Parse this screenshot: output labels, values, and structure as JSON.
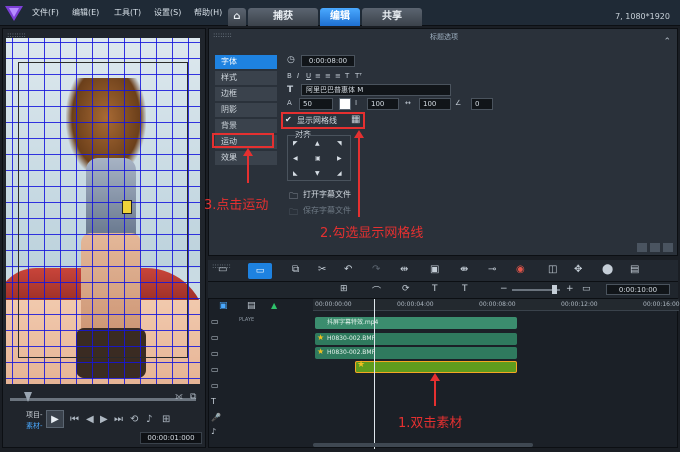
{
  "menubar": {
    "items": [
      "文件(F)",
      "编辑(E)",
      "工具(T)",
      "设置(S)",
      "帮助(H)"
    ],
    "tabs": [
      "捕获",
      "编辑",
      "共享"
    ],
    "active_tab": "编辑",
    "resolution": "7, 1080*1920"
  },
  "preview": {
    "mode_labels": [
      "项目-",
      "素材-"
    ],
    "timecode": "00:00:01:000"
  },
  "options": {
    "title": "标题选项",
    "side_tabs": [
      "字体",
      "样式",
      "边框",
      "阴影",
      "背景",
      "运动",
      "效果"
    ],
    "active_side_tab": "字体",
    "duration": "0:00:08:00",
    "font_name": "阿里巴巴普惠体 M",
    "font_size": "50",
    "line_spacing": "100",
    "char_spacing": "100",
    "rotation": "0",
    "show_grid_label": "显示网格线",
    "show_grid_checked": true,
    "align_label": "对齐",
    "open_subtitle": "打开字幕文件",
    "save_subtitle": "保存字幕文件"
  },
  "timeline": {
    "ticks": [
      "00:00:00:00",
      "00:00:04:00",
      "00:00:08:00",
      "00:00:12:00",
      "00:00:16:00"
    ],
    "end_timecode": "0:00:10:00",
    "track_label": "PLAYE",
    "clips": [
      {
        "name": "抖屏字幕特效.mp4",
        "color": "#3b8d6e"
      },
      {
        "name": "H0830-002.BMP",
        "color": "#2f7a5e"
      },
      {
        "name": "H0830-002.BMP",
        "color": "#2f7a5e"
      },
      {
        "name": "",
        "color": "#5f9c1d"
      }
    ]
  },
  "annotations": {
    "step1": "1.双击素材",
    "step2": "2.勾选显示网格线",
    "step3": "3.点击运动"
  },
  "colors": {
    "accent": "#1e82e0",
    "annotation_red": "#e53030",
    "grid_blue": "#1414dc"
  }
}
